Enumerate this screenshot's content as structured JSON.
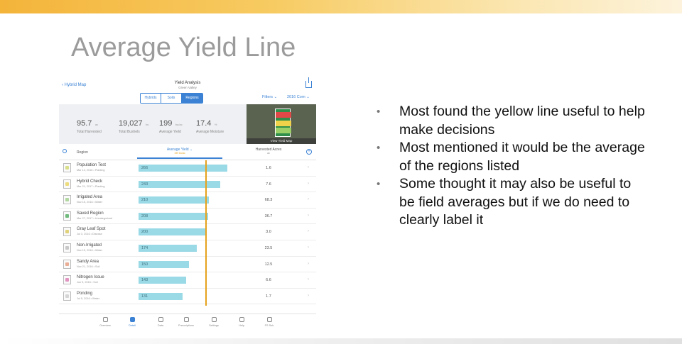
{
  "slide_title": "Average Yield Line",
  "bullets": [
    "Most found the yellow line useful to help make decisions",
    "Most mentioned it would be the average of the regions listed",
    "Some thought it may also be useful to be field averages but if we do need to clearly label it"
  ],
  "app": {
    "back_label": "Hybrid Map",
    "title": "Yield Analysis",
    "subtitle": "Green Valley",
    "segments": [
      "Hybrids",
      "Soils",
      "Regions"
    ],
    "active_segment": "Regions",
    "filters_label": "Filters",
    "crop_label": "2016 Corn",
    "stats": [
      {
        "value": "95.7",
        "unit": "ac",
        "label": "Total Harvested"
      },
      {
        "value": "19,027",
        "unit": "bu",
        "label": "Total Bushels"
      },
      {
        "value": "199",
        "unit": "bu/ac",
        "label": "Average Yield"
      },
      {
        "value": "17.4",
        "unit": "%",
        "label": "Average Moisture"
      }
    ],
    "map_label": "View Yield Map",
    "columns": {
      "region": "Region",
      "avg_yield": "Average Yield",
      "avg_yield_sub": "199 bu/ac",
      "harvested": "Harvested Acres",
      "harvested_sub": "ac"
    },
    "average_yield_value": 199,
    "yield_axis_max": 280,
    "regions": [
      {
        "name": "Population Test",
        "meta": "Mar 12, 2016 • Planting",
        "yield": 266,
        "acres": "1.6",
        "color": "#cfd86b"
      },
      {
        "name": "Hybrid Check",
        "meta": "Mar 21, 2017 • Planting",
        "yield": 243,
        "acres": "7.6",
        "color": "#e8d55c"
      },
      {
        "name": "Irrigated Area",
        "meta": "Nov 15, 2016 • Water",
        "yield": 210,
        "acres": "68.3",
        "color": "#9fcf8a"
      },
      {
        "name": "Saved Region",
        "meta": "Mar 27, 2017 • Uncategorized",
        "yield": 208,
        "acres": "36.7",
        "color": "#4caa5c"
      },
      {
        "name": "Gray Leaf Spot",
        "meta": "Jul 3, 2016 • Disease",
        "yield": 200,
        "acres": "3.0",
        "color": "#d9c85a"
      },
      {
        "name": "Non-Irrigated",
        "meta": "Nov 15, 2016 • Water",
        "yield": 174,
        "acres": "23.5",
        "color": "#bbbbbb"
      },
      {
        "name": "Sandy Area",
        "meta": "Nov 21, 2016 • Soil",
        "yield": 150,
        "acres": "12.5",
        "color": "#e39a7a"
      },
      {
        "name": "Nitrogen Issue",
        "meta": "Jun 9, 2016 • Soil",
        "yield": 143,
        "acres": "6.6",
        "color": "#d97ab0"
      },
      {
        "name": "Ponding",
        "meta": "Jul 5, 2016 • Water",
        "yield": 131,
        "acres": "1.7",
        "color": "#cccccc"
      }
    ],
    "tabs": [
      "Overview",
      "Detail",
      "Data",
      "Prescriptions",
      "Settings",
      "Help",
      "FS Sub"
    ],
    "active_tab": "Detail"
  }
}
